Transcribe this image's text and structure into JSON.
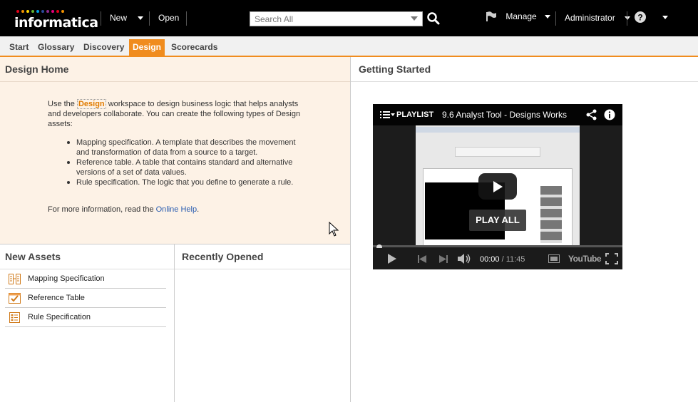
{
  "header": {
    "brand": "informatica",
    "brand_dot_colors": [
      "#e2001a",
      "#f39200",
      "#ffd500",
      "#66b32e",
      "#009fe3",
      "#2a4b9b",
      "#8c2a8c",
      "#e6007e",
      "#e2001a",
      "#f39200"
    ],
    "new_label": "New",
    "open_label": "Open",
    "search_placeholder": "Search All",
    "manage_label": "Manage",
    "user_label": "Administrator",
    "help_icon": "help-icon"
  },
  "tabs": [
    {
      "label": "Start",
      "active": false
    },
    {
      "label": "Glossary",
      "active": false
    },
    {
      "label": "Discovery",
      "active": false
    },
    {
      "label": "Design",
      "active": true
    },
    {
      "label": "Scorecards",
      "active": false
    }
  ],
  "design_home": {
    "title": "Design Home",
    "intro_pre": "Use the ",
    "intro_highlight": "Design",
    "intro_post": " workspace to design business logic that helps analysts and developers collaborate. You can create the following types of Design assets:",
    "bullets": [
      "Mapping specification. A template that describes the movement and transformation of data from a source to a target.",
      "Reference table. A table that contains standard and alternative versions of a set of data values.",
      "Rule specification. The logic that you define to generate a rule."
    ],
    "more_pre": "For more information, read the ",
    "more_link": "Online Help",
    "more_post": "."
  },
  "new_assets": {
    "title": "New Assets",
    "items": [
      {
        "label": "Mapping Specification",
        "icon": "mapping-spec-icon"
      },
      {
        "label": "Reference Table",
        "icon": "reference-table-icon"
      },
      {
        "label": "Rule Specification",
        "icon": "rule-spec-icon"
      }
    ]
  },
  "recently_opened": {
    "title": "Recently Opened"
  },
  "getting_started": {
    "title": "Getting Started",
    "video": {
      "playlist_label": "PLAYLIST",
      "video_title": "9.6 Analyst Tool - Designs Works",
      "play_all_label": "PLAY ALL",
      "current_time": "00:00",
      "time_separator": "/",
      "duration": "11:45",
      "youtube_label": "YouTube",
      "progress_fraction": 0.0
    }
  },
  "colors": {
    "accent": "#f08c1e",
    "top_bar": "#000000",
    "design_home_bg": "#fdf2e6",
    "link": "#2a5db0"
  }
}
